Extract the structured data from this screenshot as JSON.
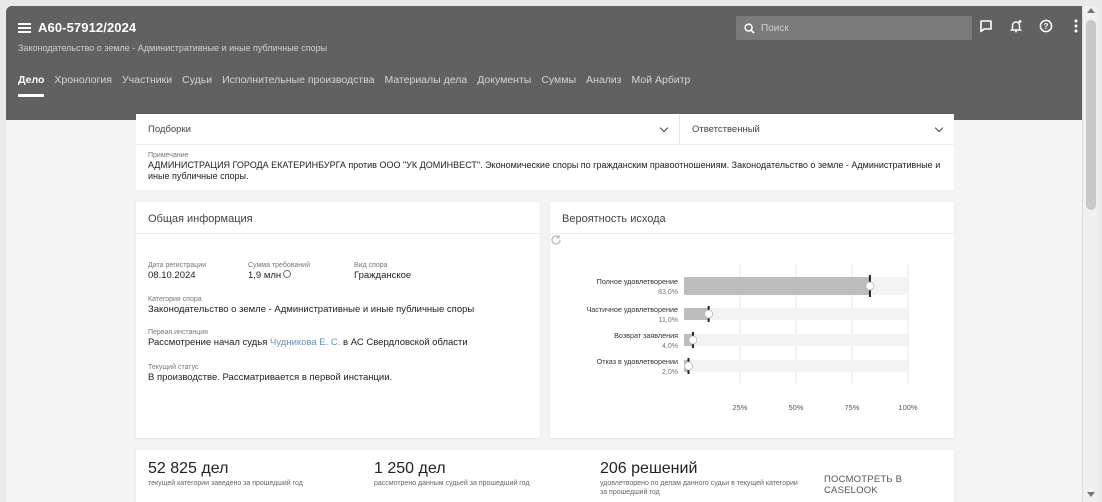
{
  "header": {
    "case_number": "А60-57912/2024",
    "case_subtitle": "Законодательство о земле - Административные и иные публичные споры",
    "search_placeholder": "Поиск"
  },
  "tabs": [
    {
      "label": "Дело",
      "active": true
    },
    {
      "label": "Хронология"
    },
    {
      "label": "Участники"
    },
    {
      "label": "Судьи"
    },
    {
      "label": "Исполнительные производства"
    },
    {
      "label": "Материалы дела"
    },
    {
      "label": "Документы"
    },
    {
      "label": "Суммы"
    },
    {
      "label": "Анализ"
    },
    {
      "label": "Мой Арбитр"
    }
  ],
  "selectors": {
    "collections_label": "Подборки",
    "responsible_label": "Ответственный"
  },
  "note": {
    "label": "Примечание",
    "text": "АДМИНИСТРАЦИЯ ГОРОДА ЕКАТЕРИНБУРГА против ООО \"УК ДОМИНВЕСТ\". Экономические споры по гражданским правоотношениям. Законодательство о земле - Административные и иные публичные споры."
  },
  "general": {
    "title": "Общая информация",
    "reg_date_label": "Дата регистрации",
    "reg_date": "08.10.2024",
    "claim_sum_label": "Сумма требований",
    "claim_sum": "1,9 млн",
    "dispute_type_label": "Вид спора",
    "dispute_type": "Гражданское",
    "category_label": "Категория спора",
    "category": "Законодательство о земле - Административные и иные публичные споры",
    "first_instance_label": "Первая инстанция",
    "first_instance_prefix": "Рассмотрение начал судья",
    "judge": "Чудникова Е. С.",
    "first_instance_suffix": "в АС Свердловской области",
    "status_label": "Текущий статус",
    "status": "В производстве. Рассматривается в первой инстанции."
  },
  "probability": {
    "title": "Вероятность исхода"
  },
  "chart_data": {
    "type": "bar",
    "orientation": "horizontal",
    "categories": [
      "Полное удовлетворение",
      "Частичное удовлетворение",
      "Возврат заявления",
      "Отказ в удовлетворении"
    ],
    "values": [
      83.0,
      11.0,
      4.0,
      2.0
    ],
    "value_labels": [
      "83,0%",
      "11,0%",
      "4,0%",
      "2,0%"
    ],
    "xlim": [
      0,
      100
    ],
    "xticks": [
      25,
      50,
      75,
      100
    ],
    "xtick_labels": [
      "25%",
      "50%",
      "75%",
      "100%"
    ],
    "bar_color": "#bdbdbd",
    "track_color": "#f3f3f3"
  },
  "stats": [
    {
      "big": "52 825 дел",
      "small": "текущей категории заведено за прошедший год"
    },
    {
      "big": "1 250 дел",
      "small": "рассмотрено данным судьей за прошедший год"
    },
    {
      "big": "206 решений",
      "small": "удовлетворено по делам данного судьи в текущей категории за прошедший год"
    }
  ],
  "caselook_label": "ПОСМОТРЕТЬ В CASELOOK"
}
